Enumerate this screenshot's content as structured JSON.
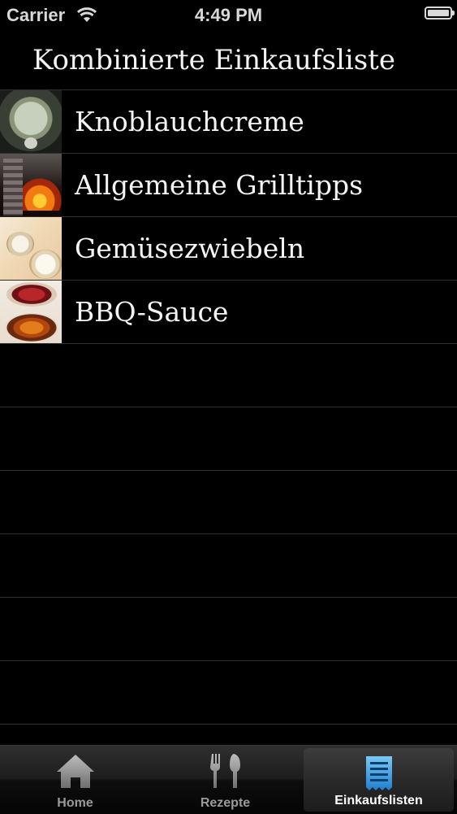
{
  "status_bar": {
    "carrier": "Carrier",
    "time": "4:49 PM"
  },
  "nav": {
    "title": "Kombinierte Einkaufsliste"
  },
  "list": {
    "items": [
      {
        "label": "Knoblauchcreme",
        "thumbnail": "garlic-cream-photo"
      },
      {
        "label": "Allgemeine Grilltipps",
        "thumbnail": "grill-fire-photo"
      },
      {
        "label": "Gemüsezwiebeln",
        "thumbnail": "onions-photo"
      },
      {
        "label": "BBQ-Sauce",
        "thumbnail": "bbq-sauce-jars-photo"
      }
    ],
    "empty_rows": 6
  },
  "tabbar": {
    "tabs": [
      {
        "label": "Home",
        "icon": "house-icon",
        "active": false
      },
      {
        "label": "Rezepte",
        "icon": "fork-knife-icon",
        "active": false
      },
      {
        "label": "Einkaufslisten",
        "icon": "list-icon",
        "active": true
      }
    ]
  },
  "colors": {
    "background": "#000000",
    "separator": "#2e2e2e",
    "active_icon": "#3a9be0"
  }
}
